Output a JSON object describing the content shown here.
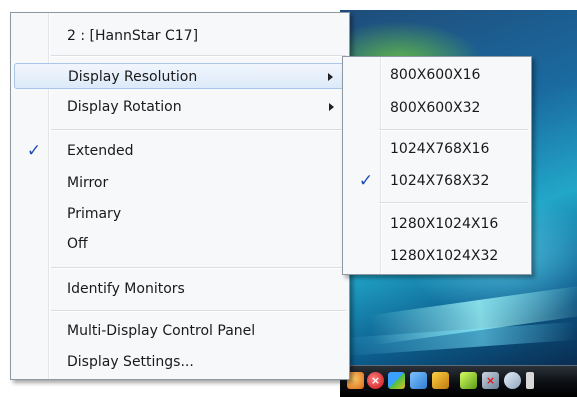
{
  "main_menu": {
    "header": "2 : [HannStar C17]",
    "display_resolution": "Display Resolution",
    "display_rotation": "Display Rotation",
    "extended": "Extended",
    "mirror": "Mirror",
    "primary": "Primary",
    "off": "Off",
    "identify_monitors": "Identify Monitors",
    "multi_display_control_panel": "Multi-Display Control Panel",
    "display_settings": "Display Settings...",
    "checked_glyph": "✓"
  },
  "resolution_menu": {
    "items": [
      "800X600X16",
      "800X600X32",
      "1024X768X16",
      "1024X768X32",
      "1280X1024X16",
      "1280X1024X32"
    ],
    "checked_glyph": "✓"
  },
  "colors": {
    "check": "#1f4fb5",
    "highlight_border": "#a9c6ea",
    "menu_background": "#f7f8fa"
  }
}
